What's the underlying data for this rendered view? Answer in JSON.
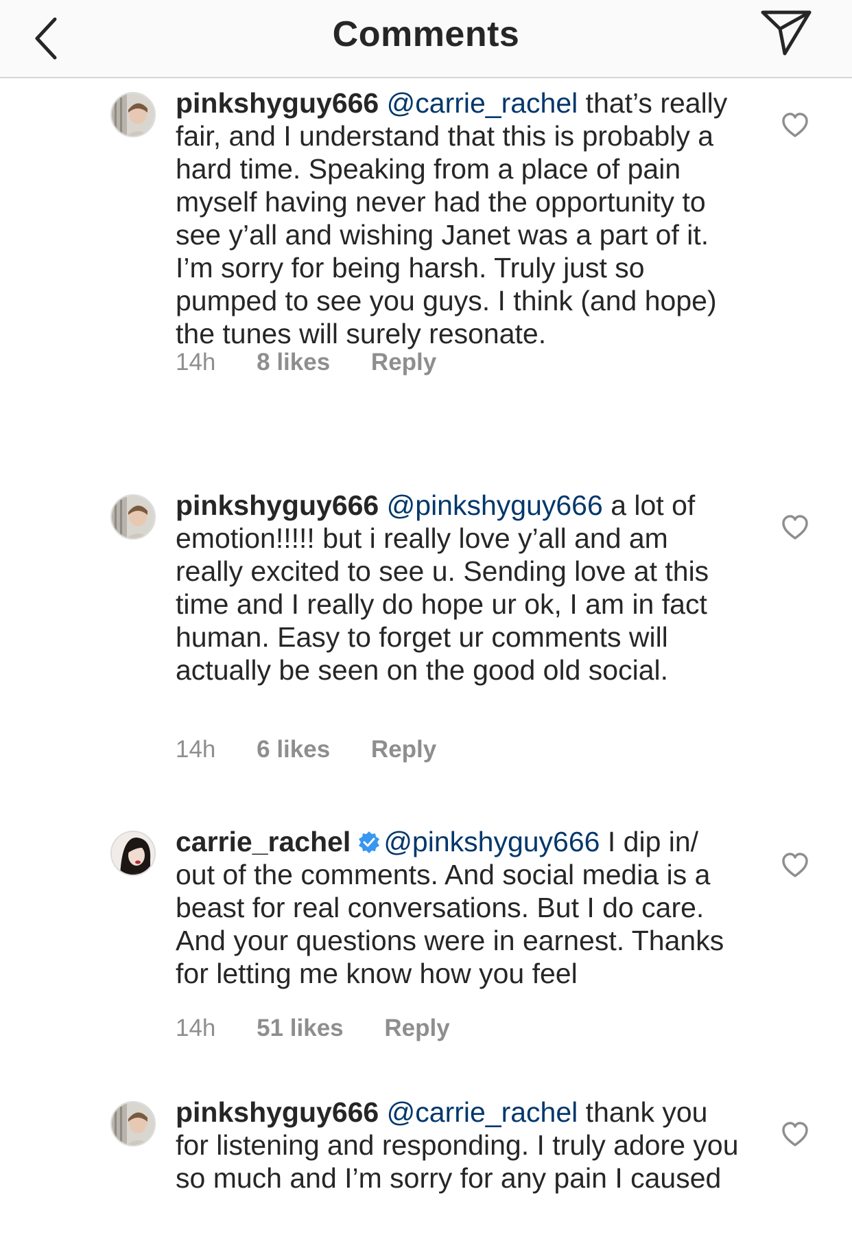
{
  "header": {
    "title": "Comments",
    "back_icon": "chevron-left-icon",
    "share_icon": "paper-plane-icon"
  },
  "colors": {
    "text": "#262626",
    "mention": "#00376b",
    "meta": "#8e8e8e",
    "verified": "#3897f0",
    "header_bg": "#fafafa"
  },
  "comments": [
    {
      "username": "pinkshyguy666",
      "verified": false,
      "mention": "@carrie_rachel",
      "text": "that’s really fair, and I understand that this is probably a hard time. Speaking from a place of pain myself having never had the opportunity to see y’all and wishing Janet was a part of it. I’m sorry for being harsh. Truly just so pumped to see you guys. I think (and hope) the tunes will surely resonate.",
      "time": "14h",
      "likes": "8 likes",
      "reply": "Reply"
    },
    {
      "username": "pinkshyguy666",
      "verified": false,
      "mention": "@pinkshyguy666",
      "text": "a lot of emotion!!!!! but i really love y’all and am really excited to see u. Sending love at this time and I really do hope ur ok, I am in fact human. Easy to forget ur comments will actually be seen on the good old social.",
      "time": "14h",
      "likes": "6 likes",
      "reply": "Reply"
    },
    {
      "username": "carrie_rachel",
      "verified": true,
      "mention": "@pinkshyguy666",
      "text": "I dip in/ out of the comments. And social media is a beast for real conversations. But I do care. And your questions were in earnest. Thanks for letting me know how you feel",
      "time": "14h",
      "likes": "51 likes",
      "reply": "Reply"
    },
    {
      "username": "pinkshyguy666",
      "verified": false,
      "mention": "@carrie_rachel",
      "text": "thank you for listening and responding. I truly adore you so much and I’m sorry for any pain I caused",
      "time": "",
      "likes": "",
      "reply": ""
    }
  ]
}
